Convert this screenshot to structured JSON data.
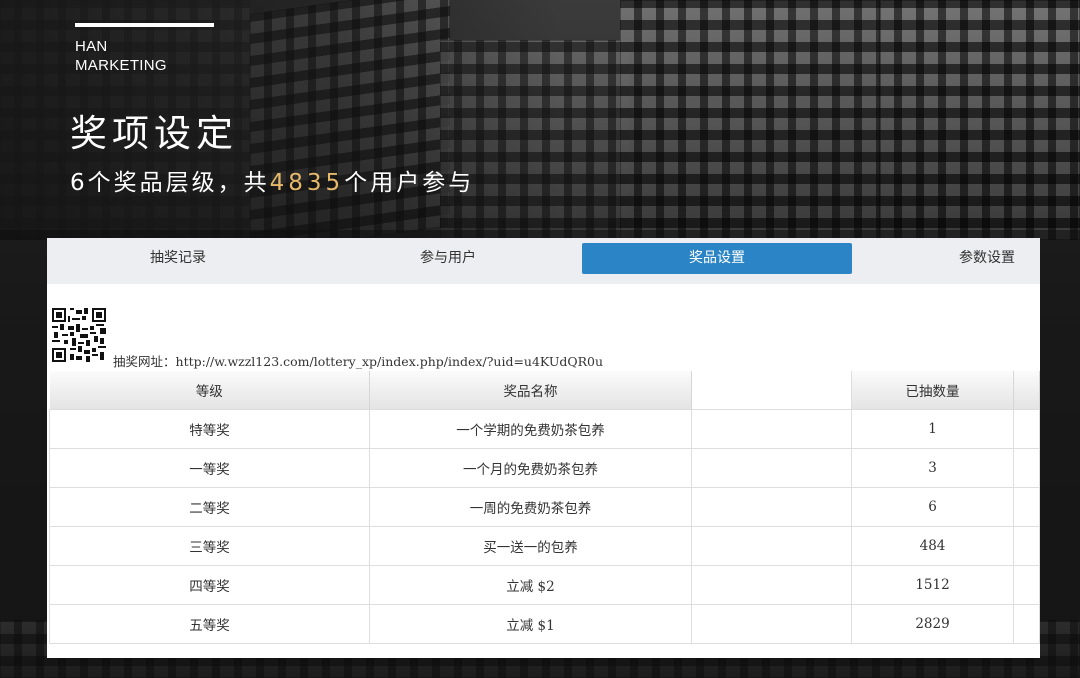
{
  "brand": {
    "line1": "HAN",
    "line2": "MARKETING"
  },
  "title": "奖项设定",
  "subtitle": {
    "prefix": "6个奖品层级，共",
    "count": "4835",
    "suffix": "个用户参与"
  },
  "colors": {
    "accent_count": "#e6b86a",
    "tab_active": "#2a84c6",
    "tab_bar": "#eceef1"
  },
  "tabs": [
    {
      "label": "抽奖记录",
      "active": false
    },
    {
      "label": "参与用户",
      "active": false
    },
    {
      "label": "奖品设置",
      "active": true
    },
    {
      "label": "参数设置",
      "active": false
    }
  ],
  "lottery": {
    "qr_icon": "qr-code-icon",
    "url_label": "抽奖网址：",
    "url": "http://w.wzzl123.com/lottery_xp/index.php/index/?uid=u4KUdQR0u"
  },
  "table": {
    "columns": [
      "等级",
      "奖品名称",
      "",
      "已抽数量",
      ""
    ],
    "rows": [
      {
        "level": "特等奖",
        "name": "一个学期的免费奶茶包养",
        "drawn": "1"
      },
      {
        "level": "一等奖",
        "name": "一个月的免费奶茶包养",
        "drawn": "3"
      },
      {
        "level": "二等奖",
        "name": "一周的免费奶茶包养",
        "drawn": "6"
      },
      {
        "level": "三等奖",
        "name": "买一送一的包养",
        "drawn": "484"
      },
      {
        "level": "四等奖",
        "name": "立减 $2",
        "drawn": "1512"
      },
      {
        "level": "五等奖",
        "name": "立减 $1",
        "drawn": "2829"
      }
    ]
  }
}
